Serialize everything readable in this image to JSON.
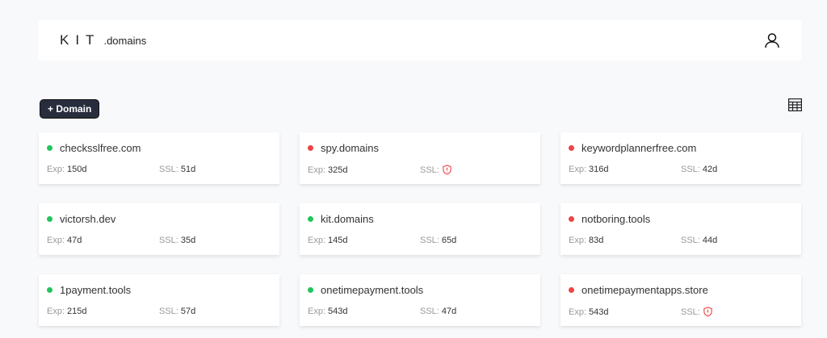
{
  "header": {
    "logo_mark": "KIT",
    "logo_suffix": ".domains"
  },
  "toolbar": {
    "add_label": "+ Domain"
  },
  "labels": {
    "exp": "Exp:",
    "ssl": "SSL:"
  },
  "colors": {
    "ok": "#22c55e",
    "error": "#ef4444",
    "button": "#272d3d"
  },
  "domains": [
    {
      "name": "checksslfree.com",
      "status": "ok",
      "exp": "150d",
      "ssl": "51d"
    },
    {
      "name": "spy.domains",
      "status": "error",
      "exp": "325d",
      "ssl": null
    },
    {
      "name": "keywordplannerfree.com",
      "status": "error",
      "exp": "316d",
      "ssl": "42d"
    },
    {
      "name": "victorsh.dev",
      "status": "ok",
      "exp": "47d",
      "ssl": "35d"
    },
    {
      "name": "kit.domains",
      "status": "ok",
      "exp": "145d",
      "ssl": "65d"
    },
    {
      "name": "notboring.tools",
      "status": "error",
      "exp": "83d",
      "ssl": "44d"
    },
    {
      "name": "1payment.tools",
      "status": "ok",
      "exp": "215d",
      "ssl": "57d"
    },
    {
      "name": "onetimepayment.tools",
      "status": "ok",
      "exp": "543d",
      "ssl": "47d"
    },
    {
      "name": "onetimepaymentapps.store",
      "status": "error",
      "exp": "543d",
      "ssl": null
    }
  ]
}
